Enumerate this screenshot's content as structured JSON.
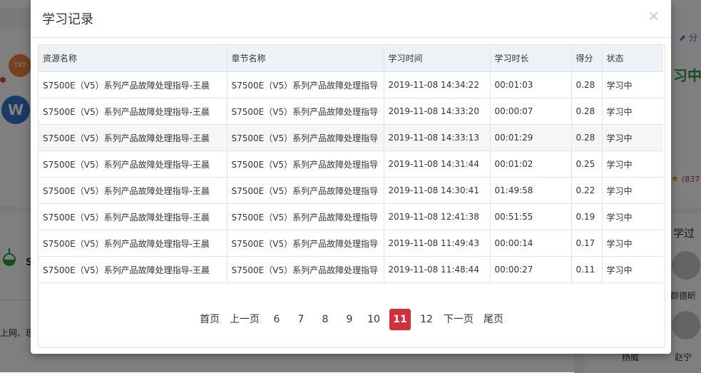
{
  "background": {
    "share_label": "分",
    "status_label": "习中",
    "rating_count": "(837",
    "learned_label": "学过",
    "bottom_text": "上网、理",
    "left_initial": "S",
    "people": [
      "颜德昕",
      "杨威",
      "赵宁"
    ],
    "bubble_txt": "TXT",
    "bubble_w": "W"
  },
  "modal": {
    "title": "学习记录",
    "close_glyph": "×"
  },
  "table": {
    "headers": {
      "resource": "资源名称",
      "chapter": "章节名称",
      "time": "学习时间",
      "duration": "学习时长",
      "score": "得分",
      "status": "状态"
    },
    "rows": [
      {
        "resource": "S7500E（V5）系列产品故障处理指导-王晨",
        "chapter": "S7500E（V5）系列产品故障处理指导",
        "time": "2019-11-08 14:34:22",
        "duration": "00:01:03",
        "score": "0.28",
        "status": "学习中"
      },
      {
        "resource": "S7500E（V5）系列产品故障处理指导-王晨",
        "chapter": "S7500E（V5）系列产品故障处理指导",
        "time": "2019-11-08 14:33:20",
        "duration": "00:00:07",
        "score": "0.28",
        "status": "学习中"
      },
      {
        "resource": "S7500E（V5）系列产品故障处理指导-王晨",
        "chapter": "S7500E（V5）系列产品故障处理指导",
        "time": "2019-11-08 14:33:13",
        "duration": "00:01:29",
        "score": "0.28",
        "status": "学习中"
      },
      {
        "resource": "S7500E（V5）系列产品故障处理指导-王晨",
        "chapter": "S7500E（V5）系列产品故障处理指导",
        "time": "2019-11-08 14:31:44",
        "duration": "00:01:02",
        "score": "0.25",
        "status": "学习中"
      },
      {
        "resource": "S7500E（V5）系列产品故障处理指导-王晨",
        "chapter": "S7500E（V5）系列产品故障处理指导",
        "time": "2019-11-08 14:30:41",
        "duration": "01:49:58",
        "score": "0.22",
        "status": "学习中"
      },
      {
        "resource": "S7500E（V5）系列产品故障处理指导-王晨",
        "chapter": "S7500E（V5）系列产品故障处理指导",
        "time": "2019-11-08 12:41:38",
        "duration": "00:51:55",
        "score": "0.19",
        "status": "学习中"
      },
      {
        "resource": "S7500E（V5）系列产品故障处理指导-王晨",
        "chapter": "S7500E（V5）系列产品故障处理指导",
        "time": "2019-11-08 11:49:43",
        "duration": "00:00:14",
        "score": "0.17",
        "status": "学习中"
      },
      {
        "resource": "S7500E（V5）系列产品故障处理指导-王晨",
        "chapter": "S7500E（V5）系列产品故障处理指导",
        "time": "2019-11-08 11:48:44",
        "duration": "00:00:27",
        "score": "0.11",
        "status": "学习中"
      }
    ]
  },
  "pagination": {
    "first": "首页",
    "prev": "上一页",
    "pages": [
      "6",
      "7",
      "8",
      "9",
      "10",
      "11",
      "12"
    ],
    "current": "11",
    "next": "下一页",
    "last": "尾页"
  },
  "colors": {
    "accent": "#d32f3c",
    "header_bg": "#eef1f5",
    "status_green": "#2c9a3e"
  }
}
